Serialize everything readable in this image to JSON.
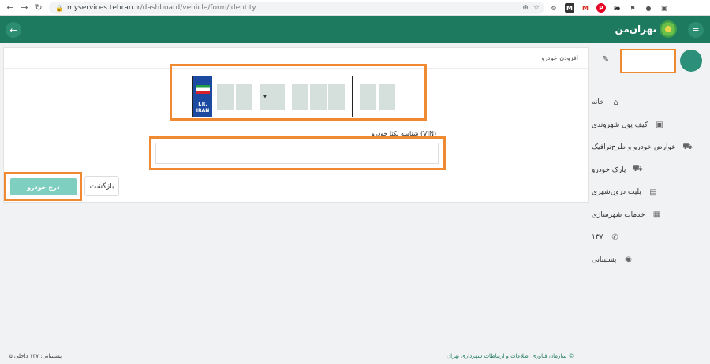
{
  "browser": {
    "url_host": "myservices.tehran.ir",
    "url_path": "/dashboard/vehicle/form/identity"
  },
  "app": {
    "logo_text": "تهران‌من"
  },
  "sidebar": {
    "items": [
      {
        "label": "خانه",
        "icon": "home-icon"
      },
      {
        "label": "کیف پول شهروندی",
        "icon": "wallet-icon"
      },
      {
        "label": "عوارض خودرو و طرح‌ترافیک",
        "icon": "car-icon"
      },
      {
        "label": "پارک خودرو",
        "icon": "parking-icon"
      },
      {
        "label": "بلیت درون‌شهری",
        "icon": "ticket-icon"
      },
      {
        "label": "خدمات شهرسازی",
        "icon": "building-icon"
      },
      {
        "label": "۱۳۷",
        "icon": "phone-icon"
      },
      {
        "label": "پشتیبانی",
        "icon": "headset-icon"
      }
    ]
  },
  "form": {
    "title": "افزودن خودرو",
    "plate_country_top": "I.R.",
    "plate_country_bottom": "IRAN",
    "vin_label": "شناسه یکتا خودرو (VIN)",
    "vin_value": "",
    "submit_label": "درج خودرو",
    "back_label": "بازگشت"
  },
  "footer": {
    "support": "پشتیبانی: ۱۳۷ داخلی ۵",
    "copyright": "© سازمان فناوری اطلاعات و ارتباطات شهرداری تهران"
  },
  "colors": {
    "brand_green": "#1d7a5e",
    "highlight_orange": "#f08a32",
    "submit_teal": "#7ecfc0"
  }
}
